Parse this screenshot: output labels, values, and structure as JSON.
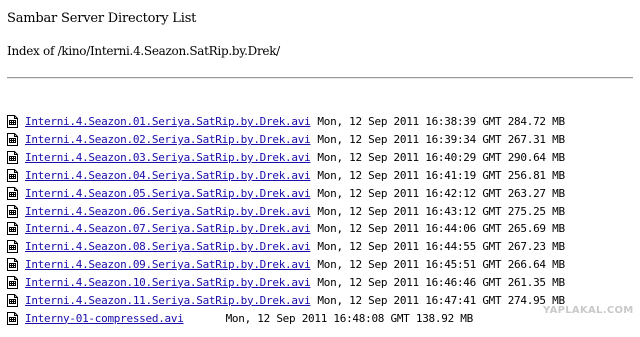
{
  "page": {
    "title": "Sambar Server Directory List",
    "index_heading": "Index of /kino/Interni.4.Seazon.SatRip.by.Drek/"
  },
  "files": [
    {
      "name": "Interni.4.Seazon.01.Seriya.SatRip.by.Drek.avi",
      "meta": "Mon, 12 Sep 2011 16:38:39 GMT 284.72 MB"
    },
    {
      "name": "Interni.4.Seazon.02.Seriya.SatRip.by.Drek.avi",
      "meta": "Mon, 12 Sep 2011 16:39:34 GMT 267.31 MB"
    },
    {
      "name": "Interni.4.Seazon.03.Seriya.SatRip.by.Drek.avi",
      "meta": "Mon, 12 Sep 2011 16:40:29 GMT 290.64 MB"
    },
    {
      "name": "Interni.4.Seazon.04.Seriya.SatRip.by.Drek.avi",
      "meta": "Mon, 12 Sep 2011 16:41:19 GMT 256.81 MB"
    },
    {
      "name": "Interni.4.Seazon.05.Seriya.SatRip.by.Drek.avi",
      "meta": "Mon, 12 Sep 2011 16:42:12 GMT 263.27 MB"
    },
    {
      "name": "Interni.4.Seazon.06.Seriya.SatRip.by.Drek.avi",
      "meta": "Mon, 12 Sep 2011 16:43:12 GMT 275.25 MB"
    },
    {
      "name": "Interni.4.Seazon.07.Seriya.SatRip.by.Drek.avi",
      "meta": "Mon, 12 Sep 2011 16:44:06 GMT 265.69 MB"
    },
    {
      "name": "Interni.4.Seazon.08.Seriya.SatRip.by.Drek.avi",
      "meta": "Mon, 12 Sep 2011 16:44:55 GMT 267.23 MB"
    },
    {
      "name": "Interni.4.Seazon.09.Seriya.SatRip.by.Drek.avi",
      "meta": "Mon, 12 Sep 2011 16:45:51 GMT 266.64 MB"
    },
    {
      "name": "Interni.4.Seazon.10.Seriya.SatRip.by.Drek.avi",
      "meta": "Mon, 12 Sep 2011 16:46:46 GMT 261.35 MB"
    },
    {
      "name": "Interni.4.Seazon.11.Seriya.SatRip.by.Drek.avi",
      "meta": "Mon, 12 Sep 2011 16:47:41 GMT 274.95 MB"
    },
    {
      "name": "Interny-01-compressed.avi",
      "meta": "Mon, 12 Sep 2011 16:48:08 GMT 138.92 MB"
    }
  ],
  "watermark": "YAPLAKAL.COM",
  "icon": "file-icon",
  "colors": {
    "link": "#1a0dab",
    "divider": "#9a9a9a"
  }
}
